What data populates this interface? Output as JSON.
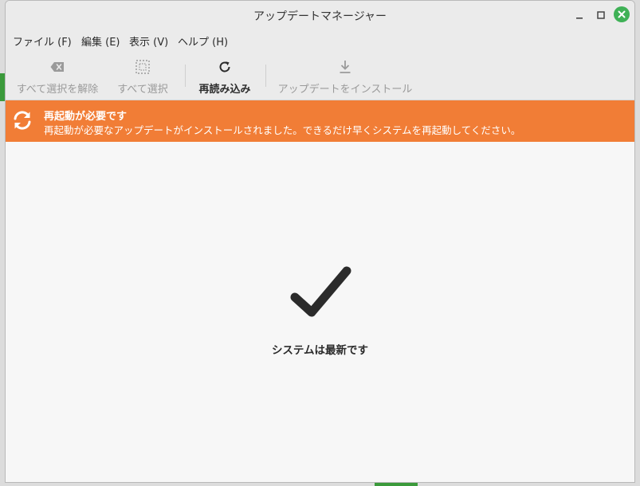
{
  "window": {
    "title": "アップデートマネージャー"
  },
  "menu": {
    "items": [
      {
        "label": "ファイル (F)"
      },
      {
        "label": "編集 (E)"
      },
      {
        "label": "表示 (V)"
      },
      {
        "label": "ヘルプ (H)"
      }
    ]
  },
  "toolbar": {
    "clear_label": "すべて選択を解除",
    "select_all_label": "すべて選択",
    "refresh_label": "再読み込み",
    "install_label": "アップデートをインストール"
  },
  "banner": {
    "heading": "再起動が必要です",
    "text": "再起動が必要なアップデートがインストールされました。できるだけ早くシステムを再起動してください。",
    "color": "#f17d36"
  },
  "main": {
    "status": "システムは最新です"
  },
  "colors": {
    "close_button": "#3fb156",
    "accent_green": "#3b9a3b"
  }
}
